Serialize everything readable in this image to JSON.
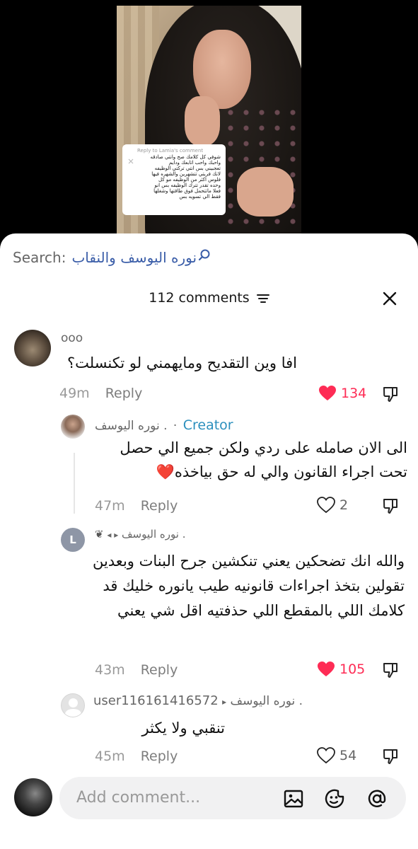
{
  "video": {
    "reply_sticker": {
      "title": "Reply to Lamia's comment",
      "lines": [
        "شوفي كل كلامك صح وانتي صادقه",
        "واحبك واحب اتابعك ودايم",
        "تعجبيني بس انتي تركتي الوظيفه",
        "لانك فريتي تتشهرين والشهره فيها",
        "فلوس اكثر من الوظيفه مو كل",
        "وحده تقدر تترك الوظيفه بس انو",
        "فعلا ماتتحمل فوق طاقتها وشغلها",
        "فقط الي تسويه بس"
      ]
    }
  },
  "search": {
    "label": "Search:",
    "term": "نوره اليوسف والنقاب"
  },
  "header": {
    "count_label": "112 comments"
  },
  "comments": [
    {
      "username": "ooo",
      "text": "افا وين التقديح ومايهمني لو تكنسلت؟",
      "time": "49m",
      "reply_label": "Reply",
      "likes": "134",
      "liked": true
    },
    {
      "username": "نوره اليوسف .",
      "separator": "·",
      "badge": "Creator",
      "text": "الى الان صامله على ردي ولكن جميع الي حصل تحت اجراء القانون والي له حق بياخذه❤️",
      "time": "47m",
      "reply_label": "Reply",
      "likes": "2",
      "liked": false
    },
    {
      "username": "نوره اليوسف .",
      "avatar_letter": "L",
      "text": "والله انك تضحكين يعني تنكشين جرح البنات وبعدين تقولين بتخذ اجراءات قانونيه طيب يانوره خليك قد كلامك اللي بالمقطع اللي حذفتيه اقل شي يعني",
      "time": "43m",
      "reply_label": "Reply",
      "likes": "105",
      "liked": true
    },
    {
      "username": "user116161416572",
      "reply_to": "نوره اليوسف .",
      "text": "تنقبي ولا يكثر",
      "time": "45m",
      "reply_label": "Reply",
      "likes": "54",
      "liked": false
    }
  ],
  "composer": {
    "placeholder": "Add comment..."
  },
  "colors": {
    "heart_liked": "#fe2c55",
    "creator": "#2b8fbd",
    "search_term": "#3a5da8"
  },
  "icons": [
    "search-icon",
    "sort-icon",
    "close-icon",
    "heart-icon",
    "dislike-icon",
    "image-icon",
    "emoji-icon",
    "mention-icon",
    "play-arrow-icon"
  ]
}
